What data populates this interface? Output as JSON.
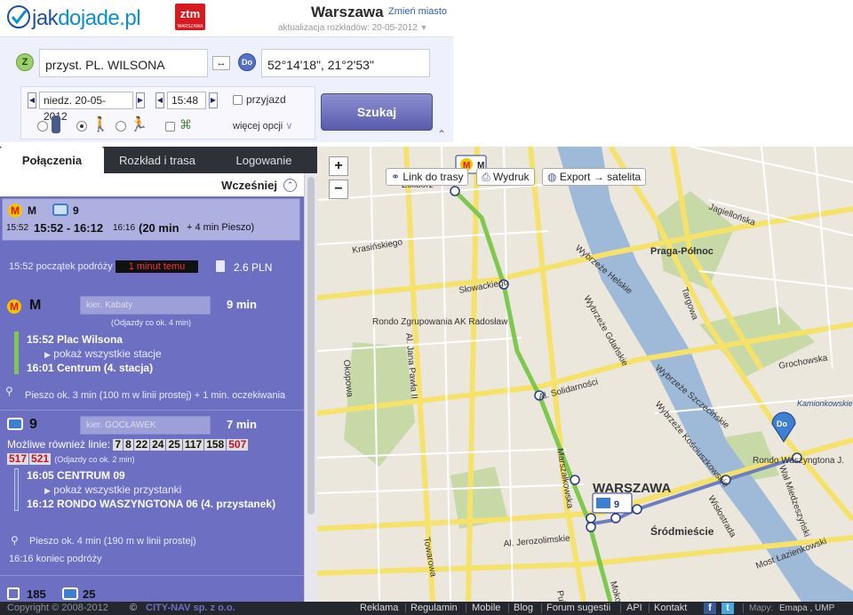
{
  "header": {
    "logo_prefix": "jak",
    "logo_rest": "dojade.pl",
    "ztm_logo": "ztm",
    "ztm_sub": "WARSZAWA",
    "city": "Warszawa",
    "change_city": "Zmień miasto",
    "update_info": "aktualizacja rozkładów: 20-05-2012"
  },
  "form": {
    "from_badge": "Z",
    "from_value": "przyst. PL. WILSONA",
    "swap_icon": "↔",
    "to_badge": "Do",
    "to_value": "52°14'18\", 21°2'53\"",
    "date_value": "niedz. 20-05-2012",
    "time_value": "15:48",
    "arrival_label": "przyjazd",
    "more_options": "więcej opcji",
    "search_label": "Szukaj"
  },
  "tabs": {
    "connections": "Połączenia",
    "schedule": "Rozkład i trasa",
    "login": "Logowanie"
  },
  "results": {
    "earlier": "Wcześniej",
    "selected": {
      "line1": "M",
      "line2": "9",
      "start_small": "15:52",
      "range": "15:52 - 16:12",
      "end_small": "16:16",
      "duration": "(20 min",
      "walk": "+ 4 min Pieszo)"
    },
    "start_text": "15:52 początek podróży",
    "ago_badge": "1 minut temu",
    "price": "2.6 PLN",
    "seg1": {
      "line": "M",
      "direction": "kier. Kabaty",
      "duration": "9 min",
      "freq": "(Odjazdy co ok. 4 min)",
      "from": "15:52 Plac Wilsona",
      "show_all": "pokaż wszystkie stacje",
      "to_time": "16:01 Centrum",
      "to_note": "(4. stacja)"
    },
    "walk1": "Pieszo ok. 3 min (100 m w linii prostej) + 1 min. oczekiwania",
    "seg2": {
      "line": "9",
      "direction": "kier. GOCŁAWEK",
      "duration": "7 min",
      "also_label": "Możliwe również linie:",
      "also_lines": [
        "7",
        "8",
        "22",
        "24",
        "25",
        "117",
        "158"
      ],
      "also_red": [
        "507"
      ],
      "also_red2": [
        "517",
        "521"
      ],
      "freq": "(Odjazdy co ok. 2 min)",
      "from": "16:05 CENTRUM 09",
      "show_all": "pokaż wszystkie przystanki",
      "to_time": "16:12 RONDO WASZYNGTONA 06",
      "to_note": "(4. przystanek)"
    },
    "walk2": "Pieszo ok. 4 min (190 m w linii prostej)",
    "end_text": "16:16 koniec podróży",
    "next": {
      "line1": "185",
      "line2": "25"
    }
  },
  "map": {
    "btn_link": "Link do trasy",
    "btn_print": "Wydruk",
    "btn_export": "Export → satelita",
    "labels": {
      "praga": "Praga-Północ",
      "warszawa": "WARSZAWA",
      "srodmiescie": "Śródmieście",
      "rondo_ak": "Rondo Zgrupowania AK Radosław",
      "zoliborz": "Zoliborz",
      "kamionkowskie": "Kamionkowskie",
      "rondo_wasz": "Rondo Waszyngtona J.",
      "wybrzeze_helskie": "Wybrzeże Helskie",
      "wybrzeze_gdanskie": "Wybrzeże Gdańskie",
      "wybrzeze_szczecinskie": "Wybrzeże Szczecińskie",
      "wybrzeze_kosciuszkowskie": "Wybrzeże Kościuszkowskie",
      "al_solidarnosci": "Al. Solidarności",
      "al_jerozolimskie": "Al. Jerozolimskie",
      "al_jana_pawla": "Al. Jana Pawła II",
      "marszalkowska": "Marszałkowska",
      "wislostrada": "Wisłostrada",
      "lazienkowski": "Most Łazienkowski",
      "wal_miedzeszynski": "Wał Miedzeszyński",
      "okopowa": "Okopowa",
      "towarowa": "Towarowa",
      "jagiellonska": "Jagiellońska",
      "targowa": "Targowa",
      "grochowska": "Grochowska",
      "slowackiego": "Słowackiego",
      "krasinskiego": "Krasińskiego",
      "mokotowska": "Mokotowska",
      "pulawska": "Puławska"
    },
    "marker_metro": "M",
    "marker_tram": "9",
    "marker_dest": "Do",
    "colors": {
      "route_metro": "#7ec850",
      "route_tram": "#6d7fc0"
    }
  },
  "footer": {
    "copyright": "Copyright © 2008-2012",
    "company": "CITY-NAV sp. z o.o.",
    "links": [
      "Reklama",
      "Regulamin",
      "Mobile",
      "Blog",
      "Forum sugestii",
      "API",
      "Kontakt"
    ],
    "maps": "Mapy:",
    "maps_by": "Emapa , UMP"
  }
}
